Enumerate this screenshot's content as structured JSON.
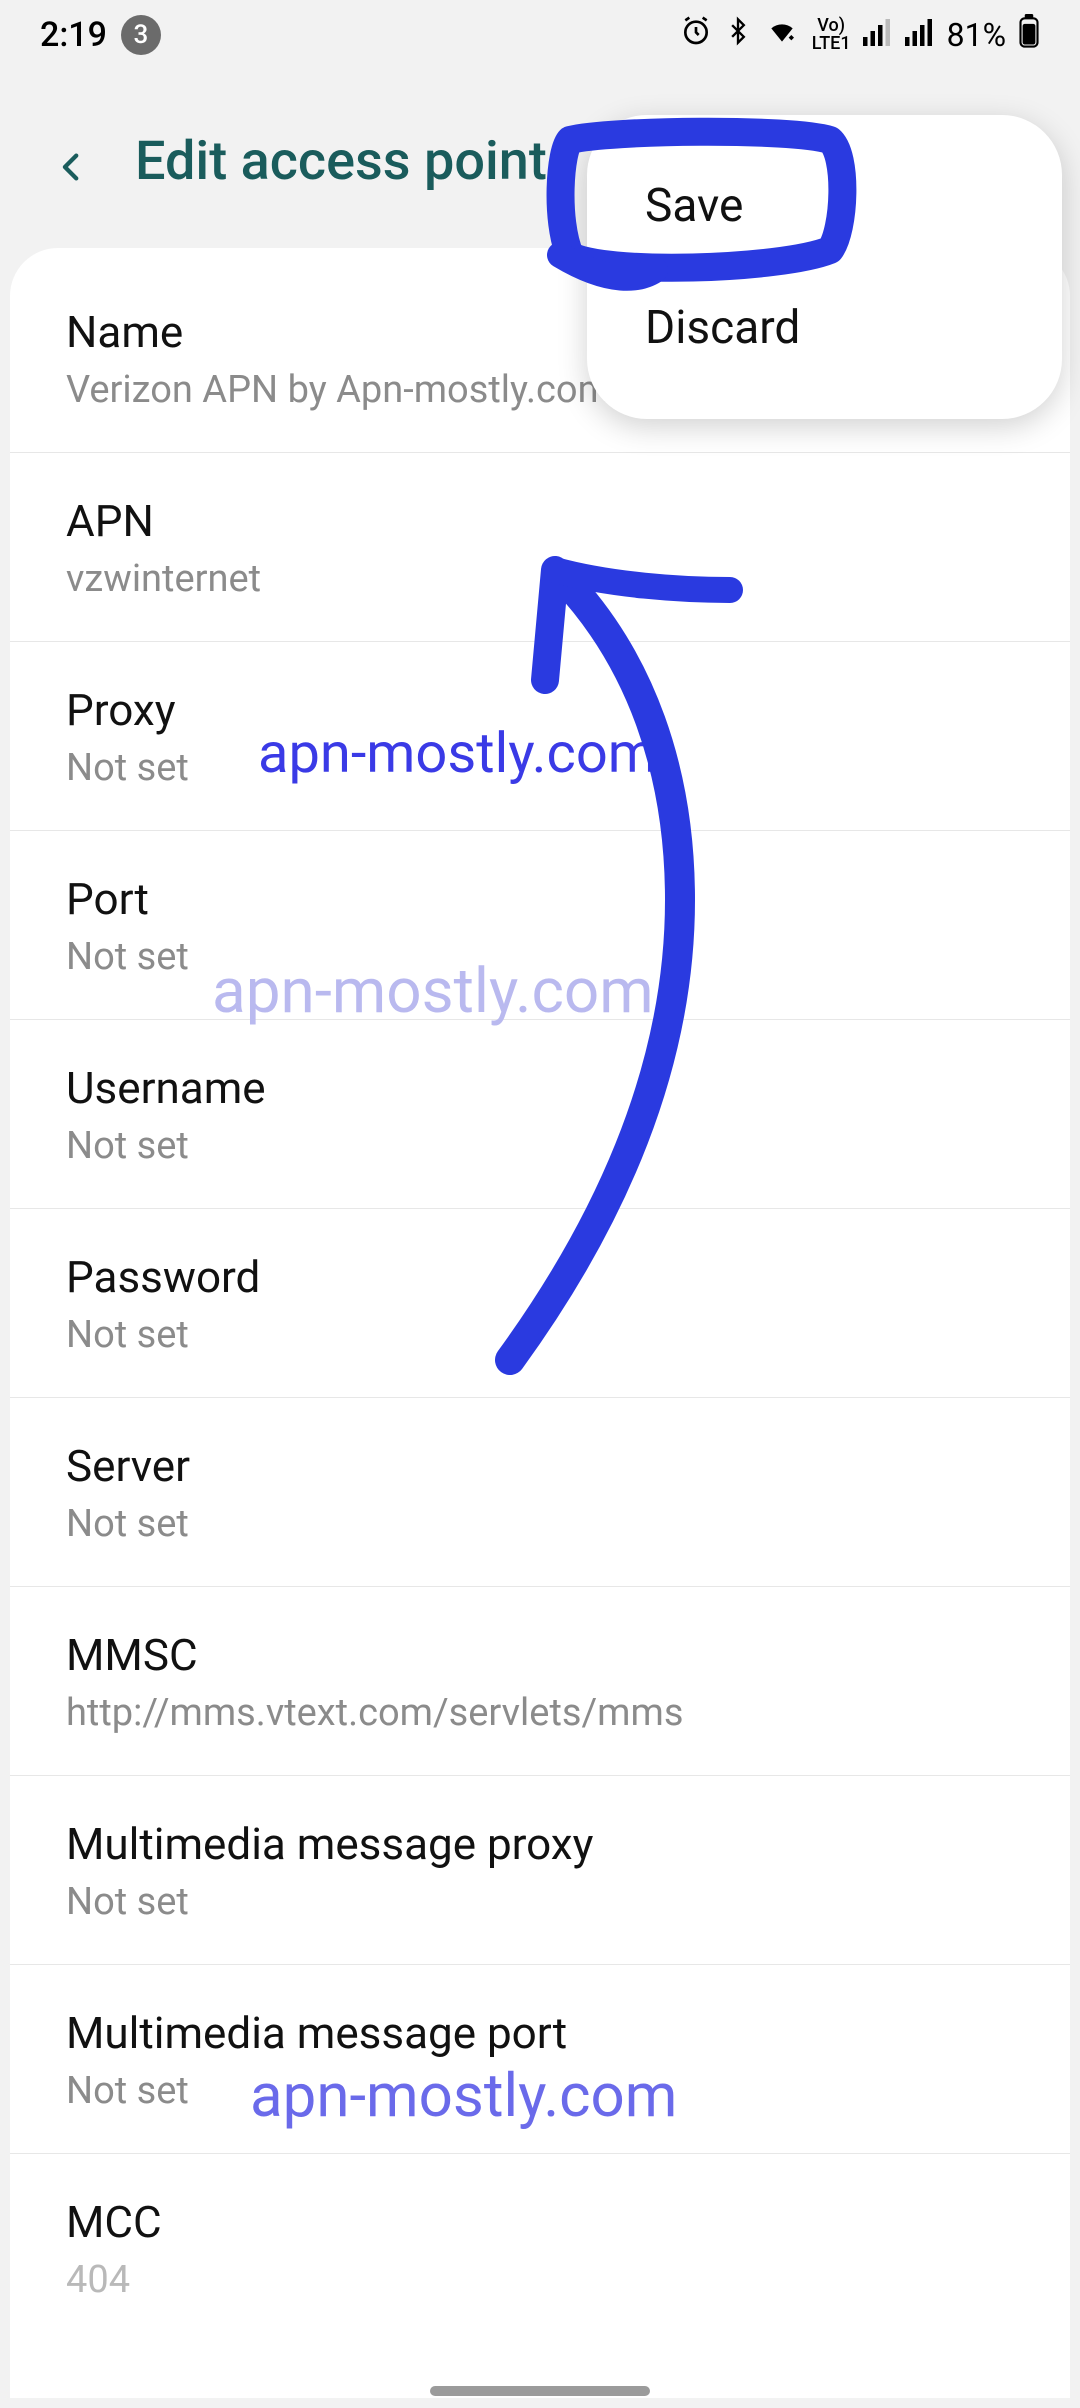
{
  "statusbar": {
    "time": "2:19",
    "notif_count": "3",
    "battery": "81%"
  },
  "header": {
    "title": "Edit access point"
  },
  "popup": {
    "save": "Save",
    "discard": "Discard"
  },
  "rows": {
    "name": {
      "label": "Name",
      "value": "Verizon APN by Apn-mostly.com"
    },
    "apn": {
      "label": "APN",
      "value": "vzwinternet"
    },
    "proxy": {
      "label": "Proxy",
      "value": "Not set"
    },
    "port": {
      "label": "Port",
      "value": "Not set"
    },
    "user": {
      "label": "Username",
      "value": "Not set"
    },
    "pass": {
      "label": "Password",
      "value": "Not set"
    },
    "server": {
      "label": "Server",
      "value": "Not set"
    },
    "mmsc": {
      "label": "MMSC",
      "value": "http://mms.vtext.com/servlets/mms"
    },
    "mmproxy": {
      "label": "Multimedia message proxy",
      "value": "Not set"
    },
    "mmport": {
      "label": "Multimedia message port",
      "value": "Not set"
    },
    "mcc": {
      "label": "MCC",
      "value": "404"
    }
  },
  "watermark": "apn-mostly.com"
}
